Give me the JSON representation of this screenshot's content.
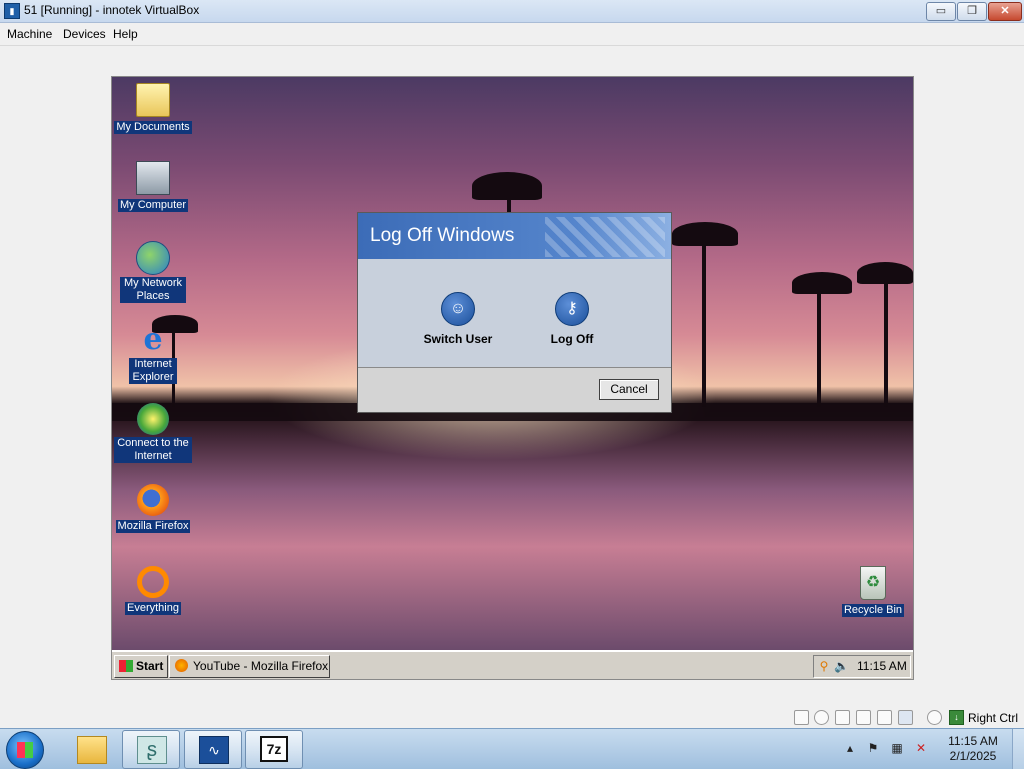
{
  "window": {
    "title": "51 [Running] - innotek VirtualBox",
    "app_icon": "vbox-icon",
    "btn_min": "▭",
    "btn_max": "❐",
    "btn_close": "✕"
  },
  "menu": [
    "Machine",
    "Devices",
    "Help"
  ],
  "desktop_icons": [
    {
      "label": "My Documents",
      "icon": "folder-icon"
    },
    {
      "label": "My Computer",
      "icon": "computer-icon"
    },
    {
      "label": "My Network Places",
      "icon": "network-icon"
    },
    {
      "label": "Internet Explorer",
      "icon": "ie-icon"
    },
    {
      "label": "Connect to the Internet",
      "icon": "connect-icon"
    },
    {
      "label": "Mozilla Firefox",
      "icon": "firefox-icon"
    },
    {
      "label": "Everything",
      "icon": "everything-icon"
    },
    {
      "label": "Recycle Bin",
      "icon": "recycle-bin-icon"
    }
  ],
  "dialog": {
    "title": "Log Off Windows",
    "switch_user": "Switch User",
    "log_off": "Log Off",
    "cancel": "Cancel"
  },
  "guest_taskbar": {
    "start": "Start",
    "task": "YouTube - Mozilla Firefox",
    "time": "11:15 AM"
  },
  "statusbar": {
    "host_key": "Right Ctrl"
  },
  "host_taskbar": {
    "time": "11:15 AM",
    "date": "2/1/2025"
  }
}
